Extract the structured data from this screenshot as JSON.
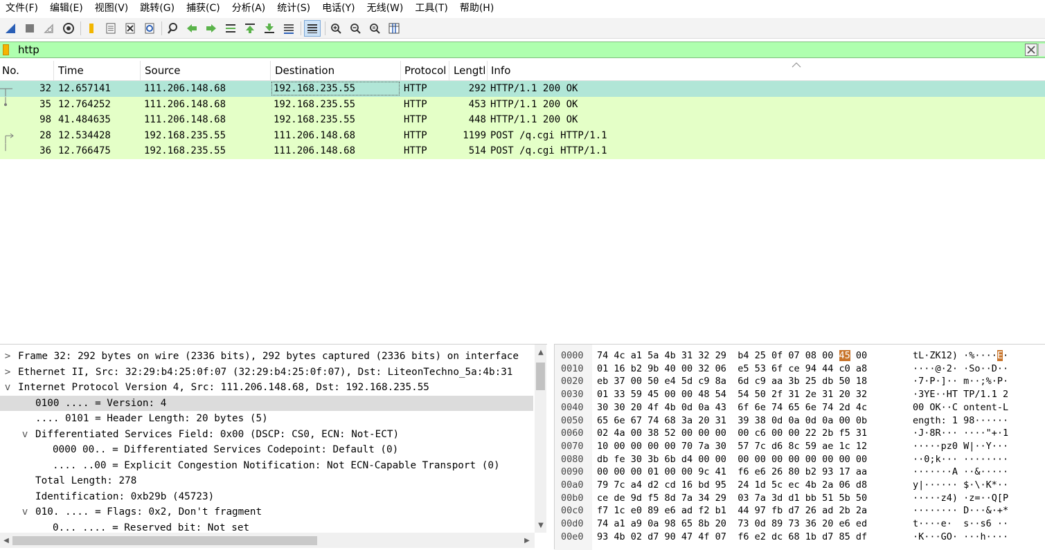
{
  "menu": [
    "文件(F)",
    "编辑(E)",
    "视图(V)",
    "跳转(G)",
    "捕获(C)",
    "分析(A)",
    "统计(S)",
    "电话(Y)",
    "无线(W)",
    "工具(T)",
    "帮助(H)"
  ],
  "toolbar": {
    "icons": [
      "shark-fin-start-icon",
      "stop-capture-icon",
      "restart-capture-icon",
      "capture-options-icon",
      "open-file-icon",
      "file-set-icon",
      "close-file-icon",
      "reload-file-icon",
      "find-packet-icon",
      "go-back-icon",
      "go-forward-icon",
      "go-to-packet-icon",
      "first-packet-icon",
      "last-packet-icon",
      "autoscroll-icon",
      "colorize-icon",
      "zoom-in-icon",
      "zoom-out-icon",
      "normal-size-icon",
      "resize-columns-icon"
    ]
  },
  "filter": {
    "value": "http"
  },
  "packet_list": {
    "columns": [
      "No.",
      "Time",
      "Source",
      "Destination",
      "Protocol",
      "Lengtl",
      "Info"
    ],
    "rows": [
      {
        "no": "32",
        "time": "12.657141",
        "src": "111.206.148.68",
        "dst": "192.168.235.55",
        "proto": "HTTP",
        "len": "292",
        "info": "HTTP/1.1 200 OK",
        "selected": true
      },
      {
        "no": "35",
        "time": "12.764252",
        "src": "111.206.148.68",
        "dst": "192.168.235.55",
        "proto": "HTTP",
        "len": "453",
        "info": "HTTP/1.1 200 OK",
        "selected": false
      },
      {
        "no": "98",
        "time": "41.484635",
        "src": "111.206.148.68",
        "dst": "192.168.235.55",
        "proto": "HTTP",
        "len": "448",
        "info": "HTTP/1.1 200 OK",
        "selected": false
      },
      {
        "no": "28",
        "time": "12.534428",
        "src": "192.168.235.55",
        "dst": "111.206.148.68",
        "proto": "HTTP",
        "len": "1199",
        "info": "POST /q.cgi HTTP/1.1",
        "selected": false
      },
      {
        "no": "36",
        "time": "12.766475",
        "src": "192.168.235.55",
        "dst": "111.206.148.68",
        "proto": "HTTP",
        "len": "514",
        "info": "POST /q.cgi HTTP/1.1",
        "selected": false
      }
    ]
  },
  "details": {
    "lines": [
      {
        "exp": ">",
        "indent": 0,
        "text": "Frame 32: 292 bytes on wire (2336 bits), 292 bytes captured (2336 bits) on interface"
      },
      {
        "exp": ">",
        "indent": 0,
        "text": "Ethernet II, Src: 32:29:b4:25:0f:07 (32:29:b4:25:0f:07), Dst: LiteonTechno_5a:4b:31"
      },
      {
        "exp": "v",
        "indent": 0,
        "text": "Internet Protocol Version 4, Src: 111.206.148.68, Dst: 192.168.235.55"
      },
      {
        "exp": "",
        "indent": 1,
        "text": "0100 .... = Version: 4",
        "highlight": true
      },
      {
        "exp": "",
        "indent": 1,
        "text": ".... 0101 = Header Length: 20 bytes (5)"
      },
      {
        "exp": "v",
        "indent": 1,
        "text": "Differentiated Services Field: 0x00 (DSCP: CS0, ECN: Not-ECT)"
      },
      {
        "exp": "",
        "indent": 2,
        "text": "0000 00.. = Differentiated Services Codepoint: Default (0)"
      },
      {
        "exp": "",
        "indent": 2,
        "text": ".... ..00 = Explicit Congestion Notification: Not ECN-Capable Transport (0)"
      },
      {
        "exp": "",
        "indent": 1,
        "text": "Total Length: 278"
      },
      {
        "exp": "",
        "indent": 1,
        "text": "Identification: 0xb29b (45723)"
      },
      {
        "exp": "v",
        "indent": 1,
        "text": "010. .... = Flags: 0x2, Don't fragment"
      },
      {
        "exp": "",
        "indent": 2,
        "text": "0... .... = Reserved bit: Not set"
      }
    ]
  },
  "bytes": {
    "lines": [
      {
        "off": "0000",
        "hex1": "74 4c a1 5a 4b 31 32 29",
        "hex2": "b4 25 0f 07 08 00 ",
        "hexhl": "45",
        "hex3": " 00",
        "ascii1": "tL·ZK12) ·%····",
        "asciihl": "E",
        "ascii2": "·"
      },
      {
        "off": "0010",
        "hex1": "01 16 b2 9b 40 00 32 06",
        "hex2": "e5 53 6f ce 94 44 c0 a8",
        "hexhl": "",
        "hex3": "",
        "ascii1": "····@·2· ·So··D··",
        "asciihl": "",
        "ascii2": ""
      },
      {
        "off": "0020",
        "hex1": "eb 37 00 50 e4 5d c9 8a",
        "hex2": "6d c9 aa 3b 25 db 50 18",
        "hexhl": "",
        "hex3": "",
        "ascii1": "·7·P·]·· m··;%·P·",
        "asciihl": "",
        "ascii2": ""
      },
      {
        "off": "0030",
        "hex1": "01 33 59 45 00 00 48 54",
        "hex2": "54 50 2f 31 2e 31 20 32",
        "hexhl": "",
        "hex3": "",
        "ascii1": "·3YE··HT TP/1.1 2",
        "asciihl": "",
        "ascii2": ""
      },
      {
        "off": "0040",
        "hex1": "30 30 20 4f 4b 0d 0a 43",
        "hex2": "6f 6e 74 65 6e 74 2d 4c",
        "hexhl": "",
        "hex3": "",
        "ascii1": "00 OK··C ontent-L",
        "asciihl": "",
        "ascii2": ""
      },
      {
        "off": "0050",
        "hex1": "65 6e 67 74 68 3a 20 31",
        "hex2": "39 38 0d 0a 0d 0a 00 0b",
        "hexhl": "",
        "hex3": "",
        "ascii1": "ength: 1 98······",
        "asciihl": "",
        "ascii2": ""
      },
      {
        "off": "0060",
        "hex1": "02 4a 00 38 52 00 00 00",
        "hex2": "00 c6 00 00 22 2b f5 31",
        "hexhl": "",
        "hex3": "",
        "ascii1": "·J·8R··· ····\"+·1",
        "asciihl": "",
        "ascii2": ""
      },
      {
        "off": "0070",
        "hex1": "10 00 00 00 00 70 7a 30",
        "hex2": "57 7c d6 8c 59 ae 1c 12",
        "hexhl": "",
        "hex3": "",
        "ascii1": "·····pz0 W|··Y···",
        "asciihl": "",
        "ascii2": ""
      },
      {
        "off": "0080",
        "hex1": "db fe 30 3b 6b d4 00 00",
        "hex2": "00 00 00 00 00 00 00 00",
        "hexhl": "",
        "hex3": "",
        "ascii1": "··0;k··· ········",
        "asciihl": "",
        "ascii2": ""
      },
      {
        "off": "0090",
        "hex1": "00 00 00 01 00 00 9c 41",
        "hex2": "f6 e6 26 80 b2 93 17 aa",
        "hexhl": "",
        "hex3": "",
        "ascii1": "·······A ··&·····",
        "asciihl": "",
        "ascii2": ""
      },
      {
        "off": "00a0",
        "hex1": "79 7c a4 d2 cd 16 bd 95",
        "hex2": "24 1d 5c ec 4b 2a 06 d8",
        "hexhl": "",
        "hex3": "",
        "ascii1": "y|······ $·\\·K*··",
        "asciihl": "",
        "ascii2": ""
      },
      {
        "off": "00b0",
        "hex1": "ce de 9d f5 8d 7a 34 29",
        "hex2": "03 7a 3d d1 bb 51 5b 50",
        "hexhl": "",
        "hex3": "",
        "ascii1": "·····z4) ·z=··Q[P",
        "asciihl": "",
        "ascii2": ""
      },
      {
        "off": "00c0",
        "hex1": "f7 1c e0 89 e6 ad f2 b1",
        "hex2": "44 97 fb d7 26 ad 2b 2a",
        "hexhl": "",
        "hex3": "",
        "ascii1": "········ D···&·+*",
        "asciihl": "",
        "ascii2": ""
      },
      {
        "off": "00d0",
        "hex1": "74 a1 a9 0a 98 65 8b 20",
        "hex2": "73 0d 89 73 36 20 e6 ed",
        "hexhl": "",
        "hex3": "",
        "ascii1": "t····e·  s··s6 ··",
        "asciihl": "",
        "ascii2": ""
      },
      {
        "off": "00e0",
        "hex1": "93 4b 02 d7 90 47 4f 07",
        "hex2": "f6 e2 dc 68 1b d7 85 df",
        "hexhl": "",
        "hex3": "",
        "ascii1": "·K···GO· ···h····",
        "asciihl": "",
        "ascii2": ""
      }
    ]
  }
}
